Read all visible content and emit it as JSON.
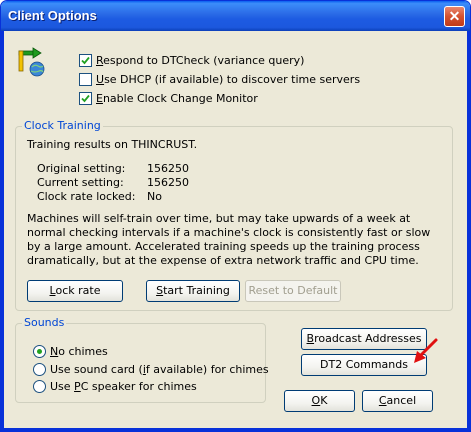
{
  "window": {
    "title": "Client Options",
    "close_glyph": "✕",
    "icon": "app-tools-icon"
  },
  "top_options": [
    {
      "pre": "",
      "u": "R",
      "post": "espond to DTCheck (variance query)",
      "checked": true
    },
    {
      "pre": "",
      "u": "U",
      "post": "se DHCP (if available) to discover time servers",
      "checked": false
    },
    {
      "pre": "",
      "u": "E",
      "post": "nable Clock Change Monitor",
      "checked": true
    }
  ],
  "clock_training": {
    "title": "Clock Training",
    "results": "Training results on THINCRUST.",
    "rows": [
      {
        "label": "Original setting:",
        "value": "156250"
      },
      {
        "label": "Current setting:",
        "value": "156250"
      },
      {
        "label": "Clock rate locked:",
        "value": "No"
      }
    ],
    "description": "Machines will self-train over time, but may take upwards of a week at normal checking intervals if a machine's clock is consistently fast or slow by a large amount. Accelerated training speeds up the training process dramatically, but at the expense of extra network traffic and CPU time.",
    "buttons": {
      "lock_rate": {
        "u": "L",
        "post": "ock rate"
      },
      "start_training": {
        "u": "S",
        "post": "tart Training"
      },
      "reset_default": "Reset to Default"
    }
  },
  "sounds": {
    "title": "Sounds",
    "options": [
      {
        "pre": "",
        "u": "N",
        "post": "o chimes",
        "selected": true
      },
      {
        "pre": "Use sound card (",
        "u": "i",
        "post": "f available) for chimes",
        "selected": false
      },
      {
        "pre": "Use ",
        "u": "P",
        "post": "C speaker for chimes",
        "selected": false
      }
    ]
  },
  "buttons": {
    "broadcast": {
      "u": "B",
      "post": "roadcast Addresses"
    },
    "dt2": "DT2 Commands",
    "ok": {
      "u": "O",
      "post": "K"
    },
    "cancel": {
      "u": "C",
      "post": "ancel"
    }
  },
  "colors": {
    "title_bar": "#1c58de",
    "accent": "#0046d5",
    "check": "#21a121",
    "annotation_arrow": "#e01010"
  }
}
